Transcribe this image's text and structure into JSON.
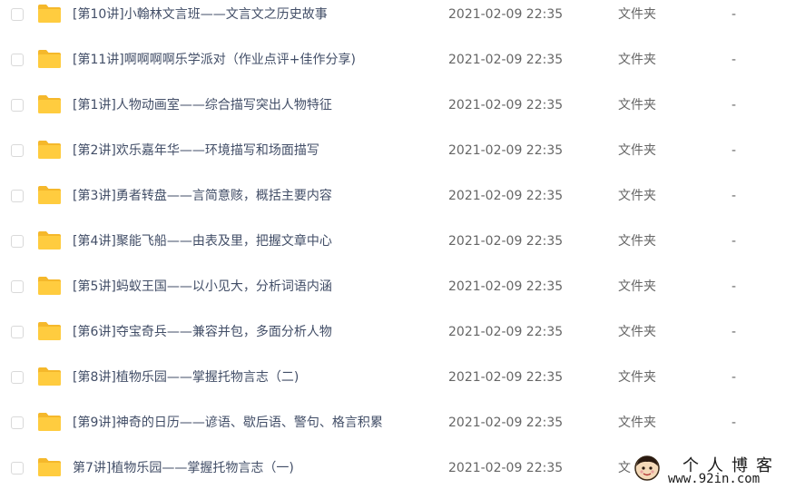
{
  "files": [
    {
      "name": "[第10讲]小翰林文言班——文言文之历史故事",
      "date": "2021-02-09 22:35",
      "type": "文件夹",
      "size": "-"
    },
    {
      "name": "[第11讲]啊啊啊啊乐学派对（作业点评+佳作分享)",
      "date": "2021-02-09 22:35",
      "type": "文件夹",
      "size": "-"
    },
    {
      "name": "[第1讲]人物动画室——综合描写突出人物特征",
      "date": "2021-02-09 22:35",
      "type": "文件夹",
      "size": "-"
    },
    {
      "name": "[第2讲]欢乐嘉年华——环境描写和场面描写",
      "date": "2021-02-09 22:35",
      "type": "文件夹",
      "size": "-"
    },
    {
      "name": "[第3讲]勇者转盘——言简意赅，概括主要内容",
      "date": "2021-02-09 22:35",
      "type": "文件夹",
      "size": "-"
    },
    {
      "name": "[第4讲]聚能飞船——由表及里，把握文章中心",
      "date": "2021-02-09 22:35",
      "type": "文件夹",
      "size": "-"
    },
    {
      "name": "[第5讲]蚂蚁王国——以小见大，分析词语内涵",
      "date": "2021-02-09 22:35",
      "type": "文件夹",
      "size": "-"
    },
    {
      "name": "[第6讲]夺宝奇兵——兼容并包，多面分析人物",
      "date": "2021-02-09 22:35",
      "type": "文件夹",
      "size": "-"
    },
    {
      "name": "[第8讲]植物乐园——掌握托物言志（二)",
      "date": "2021-02-09 22:35",
      "type": "文件夹",
      "size": "-"
    },
    {
      "name": "[第9讲]神奇的日历——谚语、歇后语、警句、格言积累",
      "date": "2021-02-09 22:35",
      "type": "文件夹",
      "size": "-"
    },
    {
      "name": "第7讲]植物乐园——掌握托物言志（一)",
      "date": "2021-02-09 22:35",
      "type": "文",
      "size": "-"
    }
  ],
  "watermark": {
    "title": "个人博客",
    "url": "www.92in.com"
  },
  "colors": {
    "folder": "#ffcc3f",
    "folder_back": "#f5b82b",
    "name_text": "#424e67",
    "meta_text": "#666666"
  }
}
